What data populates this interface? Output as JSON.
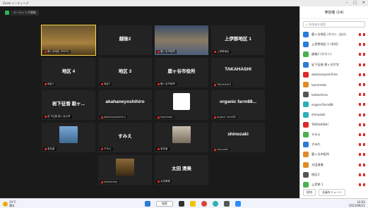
{
  "window": {
    "title": "Zoom ミーティング",
    "controls": [
      "–",
      "□",
      "✕"
    ]
  },
  "meeting": {
    "info": "ミーティング情報"
  },
  "tiles": [
    {
      "name": "",
      "label": "鹿ヶ谷地区 (RBCB)",
      "type": "person",
      "active": true
    },
    {
      "name": "越後2",
      "label": "",
      "type": "text"
    },
    {
      "name": "",
      "label": "鹿ヶ谷市役所",
      "type": "room"
    },
    {
      "name": "上伊那地区 1",
      "label": "上伊那地区",
      "type": "text"
    },
    {
      "name": "地区 4",
      "label": "地区4",
      "type": "text"
    },
    {
      "name": "地区 3",
      "label": "地区3",
      "type": "text"
    },
    {
      "name": "鹿ヶ谷市役所",
      "label": "鹿ヶ谷市役所",
      "type": "text"
    },
    {
      "name": "TAKAHASHI",
      "label": "TAKAHASHI",
      "type": "text"
    },
    {
      "name": "岩下征香 勘ヶ...",
      "label": "岩下征香 勘ヶ谷大学",
      "type": "text"
    },
    {
      "name": "akahaneyoshihiro",
      "label": "akahaneyoshihiro",
      "type": "text"
    },
    {
      "name": "",
      "label": "kanemoto",
      "type": "avatar"
    },
    {
      "name": "organic farm88...",
      "label": "organic farm88",
      "type": "text"
    },
    {
      "name": "",
      "label": "参加者",
      "type": "person2"
    },
    {
      "name": "すみえ",
      "label": "すみえ",
      "type": "text"
    },
    {
      "name": "",
      "label": "参加者",
      "type": "person3"
    },
    {
      "name": "shinozaki",
      "label": "shinozaki",
      "type": "text"
    },
    {
      "name": "",
      "label": "kaitoshima",
      "type": "statue"
    },
    {
      "name": "太田 清美",
      "label": "太田清美",
      "type": "text"
    }
  ],
  "sidebar": {
    "title": "参加者 (14)",
    "search_placeholder": "参加者を検索",
    "participants": [
      {
        "name": "鹿ヶ谷地区 (ホスト, 自分)",
        "color": "#2b7bd8"
      },
      {
        "name": "上伊那地区 1 (共同)",
        "color": "#2b7bd8"
      },
      {
        "name": "越後2 (ホスト)",
        "color": "#4caf50"
      },
      {
        "name": "岩下征香 勘ヶ谷大学",
        "color": "#2b7bd8"
      },
      {
        "name": "akahaneyoshihiro",
        "color": "#e02828"
      },
      {
        "name": "kanemoto",
        "color": "#e08a28"
      },
      {
        "name": "kaitoshima",
        "color": "#555555"
      },
      {
        "name": "organicfarm88",
        "color": "#2bb0b8"
      },
      {
        "name": "shinozaki",
        "color": "#2bb0b8"
      },
      {
        "name": "TAKAHASHI",
        "color": "#e02828"
      },
      {
        "name": "すみえ",
        "color": "#4caf50"
      },
      {
        "name": "すみれ",
        "color": "#2b7bd8"
      },
      {
        "name": "鹿ヶ谷市役所",
        "color": "#e08a28"
      },
      {
        "name": "太田清美",
        "color": "#e08a28"
      },
      {
        "name": "地区3",
        "color": "#555555"
      },
      {
        "name": "上伊那 1",
        "color": "#4caf50"
      }
    ],
    "invite_label": "招待",
    "mute_all_label": "全員をミュート"
  },
  "taskbar": {
    "weather": "24°C",
    "weather_desc": "晴れ",
    "search_label": "検索",
    "time": "14:02",
    "date": "2023/08/11"
  }
}
